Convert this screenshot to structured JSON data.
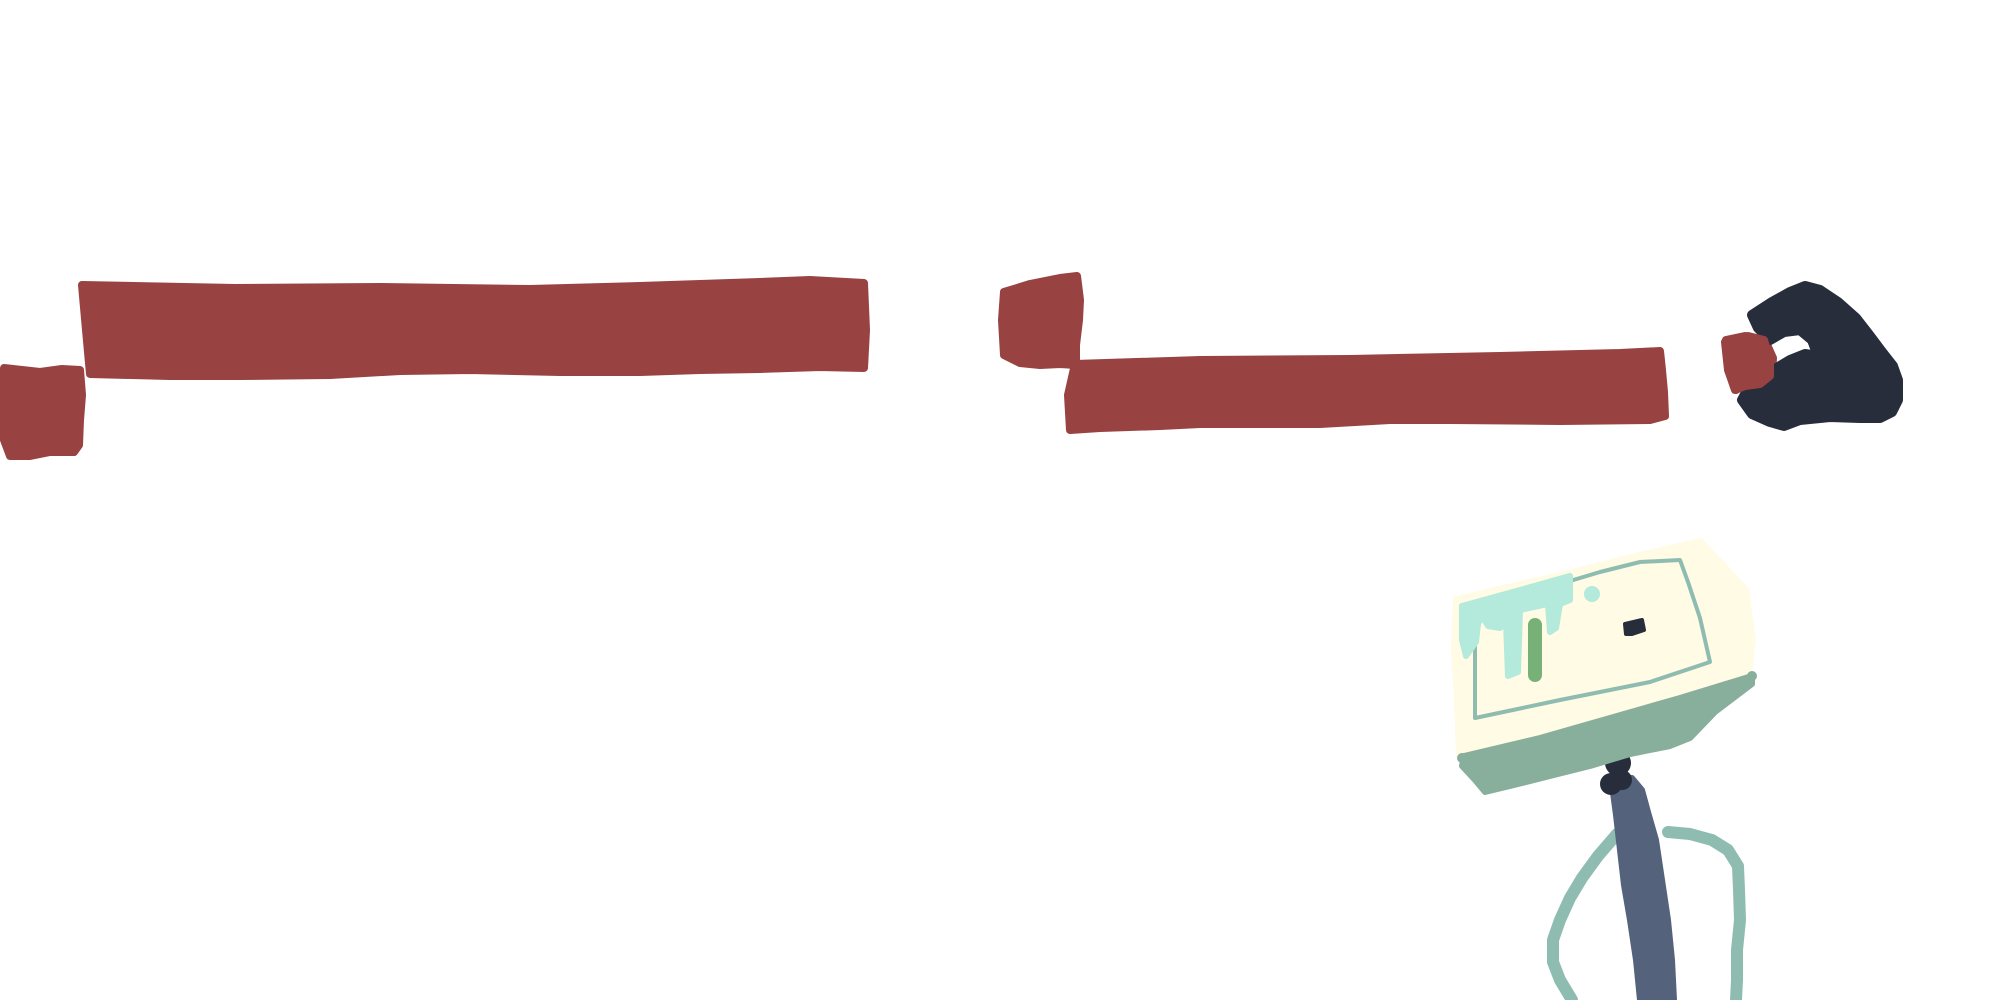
{
  "scene": {
    "background": "#ffffff",
    "palette": {
      "brick_red": "#994242",
      "dark_navy": "#272d3b",
      "slate_blue": "#55627b",
      "sage_green": "#88ae9c",
      "pale_cream": "#fffbe4",
      "mint": "#b3eadc",
      "leaf_green": "#78b177",
      "line_teal": "#8fbcb1"
    },
    "icons": [
      "brush-stroke-platform",
      "dark-rock-blob",
      "tv-monitor-character"
    ]
  }
}
